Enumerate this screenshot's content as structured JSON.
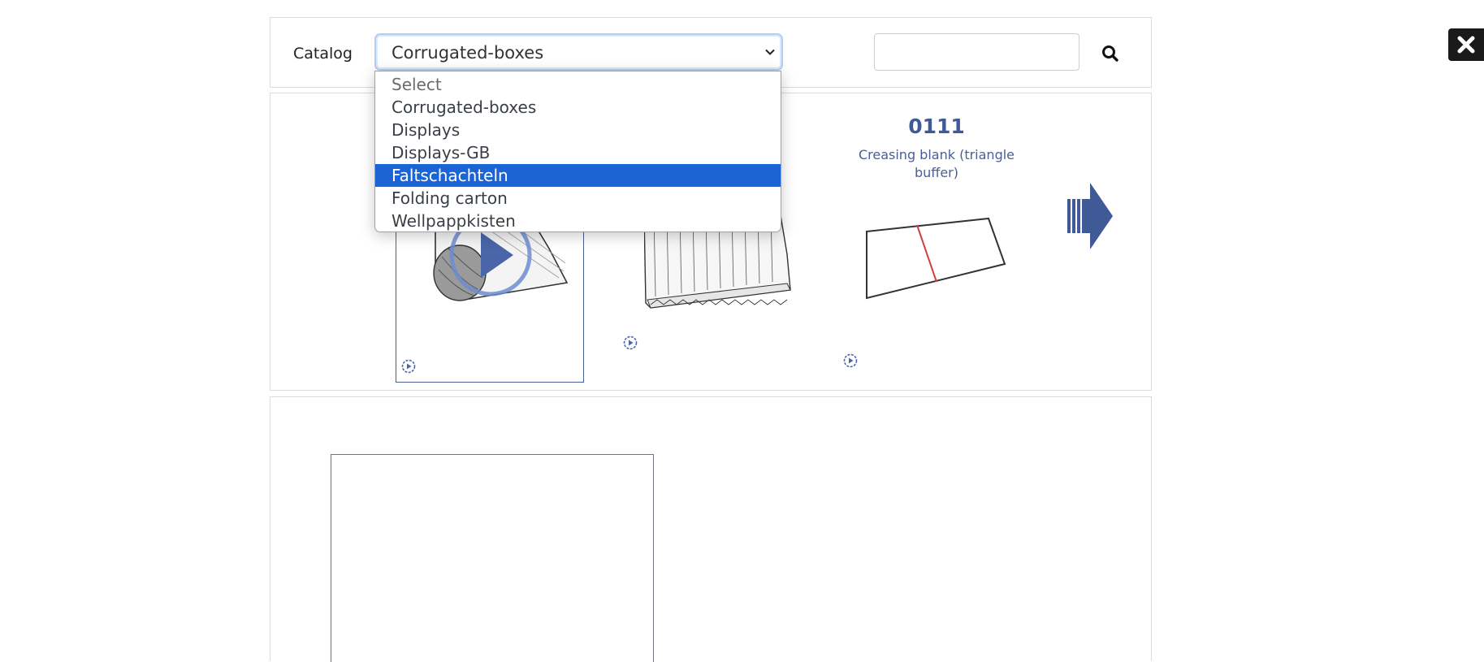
{
  "header": {
    "catalog_label": "Catalog",
    "selected_catalog": "Corrugated-boxes",
    "search_value": "",
    "search_icon": "search-icon"
  },
  "dropdown": {
    "options": [
      {
        "label": "Select",
        "state": "placeholder"
      },
      {
        "label": "Corrugated-boxes",
        "state": "normal"
      },
      {
        "label": "Displays",
        "state": "normal"
      },
      {
        "label": "Displays-GB",
        "state": "normal"
      },
      {
        "label": "Faltschachteln",
        "state": "highlighted"
      },
      {
        "label": "Folding carton",
        "state": "normal"
      },
      {
        "label": "Wellpappkisten",
        "state": "normal"
      }
    ],
    "highlight_color": "#1a64d6"
  },
  "carousel": {
    "items": [
      {
        "code": "",
        "description": "",
        "selected": true,
        "icon": "corrugated-roll-icon"
      },
      {
        "code": "",
        "description": "",
        "selected": false,
        "icon": "corrugated-sheet-icon"
      },
      {
        "code": "0111",
        "description": "Creasing blank (triangle buffer)",
        "selected": false,
        "icon": "creasing-blank-icon"
      }
    ],
    "next_icon": "arrow-right-icon",
    "accent_color": "#3f5a96"
  },
  "overlay": {
    "close_icon": "close-icon"
  }
}
